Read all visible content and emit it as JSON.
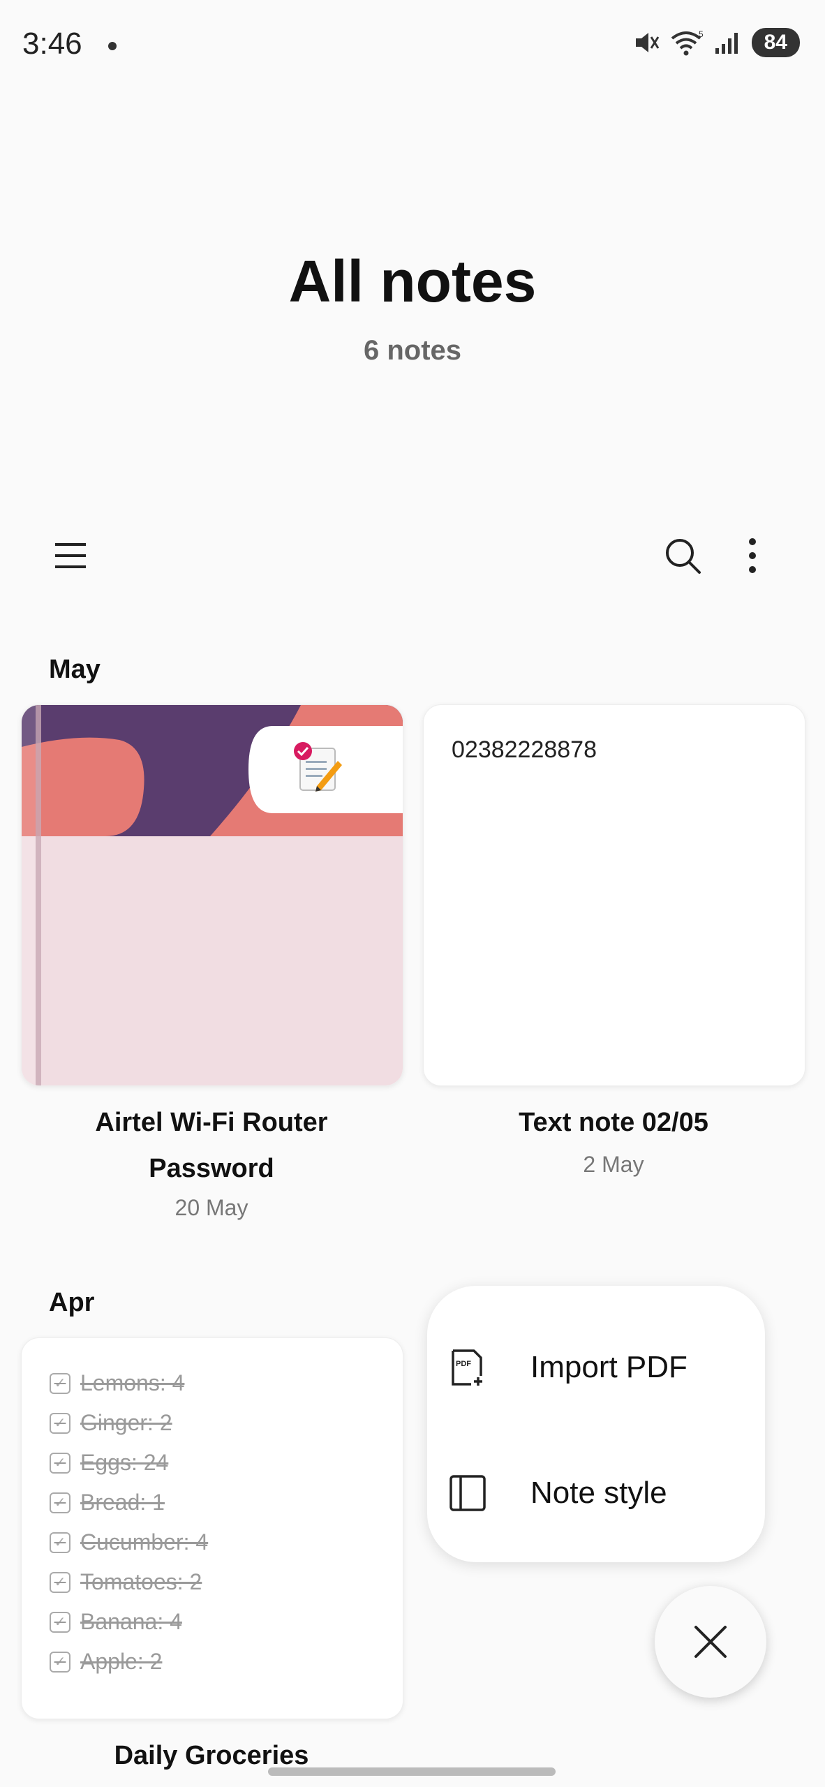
{
  "status": {
    "time": "3:46",
    "battery": "84"
  },
  "header": {
    "title": "All notes",
    "subtitle": "6 notes"
  },
  "toolbar": {
    "menu_icon": "hamburger-icon",
    "search_icon": "search-icon",
    "more_icon": "more-vertical-icon"
  },
  "sections": [
    {
      "label": "May",
      "notes": [
        {
          "title_line1": "Airtel Wi-Fi Router",
          "title_line2": "Password",
          "date": "20 May"
        },
        {
          "preview": "02382228878",
          "title": "Text note 02/05",
          "date": "2 May"
        }
      ]
    },
    {
      "label": "Apr",
      "notes": [
        {
          "title": "Daily Groceries",
          "items": [
            "Lemons: 4",
            "Ginger: 2",
            "Eggs: 24",
            "Bread: 1",
            "Cucumber: 4",
            "Tomatoes: 2",
            "Banana: 4",
            "Apple: 2"
          ]
        }
      ]
    }
  ],
  "popup_menu": {
    "items": [
      {
        "label": "Import PDF",
        "icon": "import-pdf-icon"
      },
      {
        "label": "Note style",
        "icon": "note-style-icon"
      }
    ]
  },
  "fab": {
    "icon": "close-icon"
  }
}
